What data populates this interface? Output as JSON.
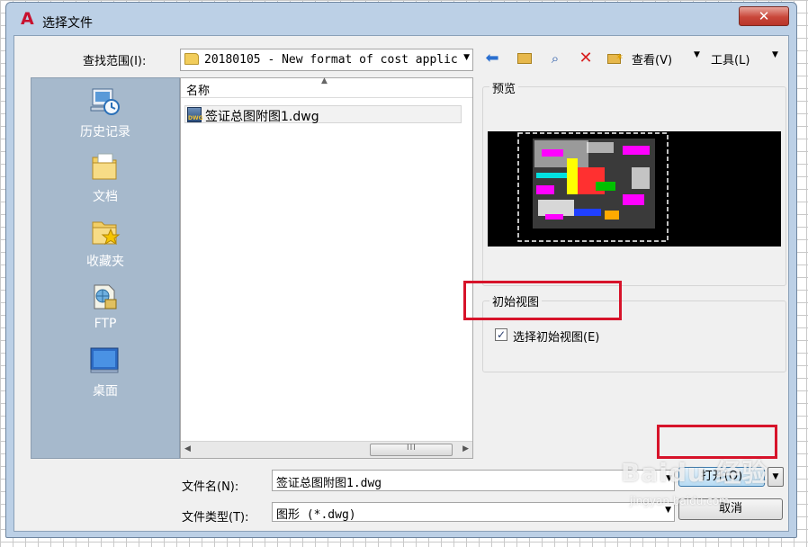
{
  "window": {
    "title": "选择文件",
    "close_glyph": "✕"
  },
  "look_in": {
    "label": "查找范围(I):",
    "value": "20180105 - New format of cost applic"
  },
  "toolbar": {
    "views_label": "查看(V)",
    "tools_label": "工具(L)"
  },
  "places": [
    {
      "label": "历史记录",
      "icon": "history-icon"
    },
    {
      "label": "文档",
      "icon": "documents-folder-icon"
    },
    {
      "label": "收藏夹",
      "icon": "favorites-folder-icon"
    },
    {
      "label": "FTP",
      "icon": "ftp-icon"
    },
    {
      "label": "桌面",
      "icon": "desktop-icon"
    }
  ],
  "file_list": {
    "column_name": "名称",
    "files": [
      {
        "name": "签证总图附图1.dwg",
        "icon": "dwg-file-icon",
        "icon_text": "DWG"
      }
    ],
    "scroll_grip": "III"
  },
  "preview": {
    "legend": "预览"
  },
  "initial_view": {
    "legend": "初始视图",
    "checkbox_label": "选择初始视图(E)",
    "checked": true
  },
  "filename": {
    "label": "文件名(N):",
    "value": "签证总图附图1.dwg"
  },
  "filetype": {
    "label": "文件类型(T):",
    "value": "图形 (*.dwg)"
  },
  "buttons": {
    "open_label": "打开(O)",
    "cancel_label": "取消"
  },
  "watermark": {
    "text": "Baidu 经验",
    "sub": "jingyan.baidu.com"
  },
  "colors": {
    "highlight": "#d7132a",
    "places_bar": "#a6b9cc",
    "frame": "#bcd0e6"
  }
}
